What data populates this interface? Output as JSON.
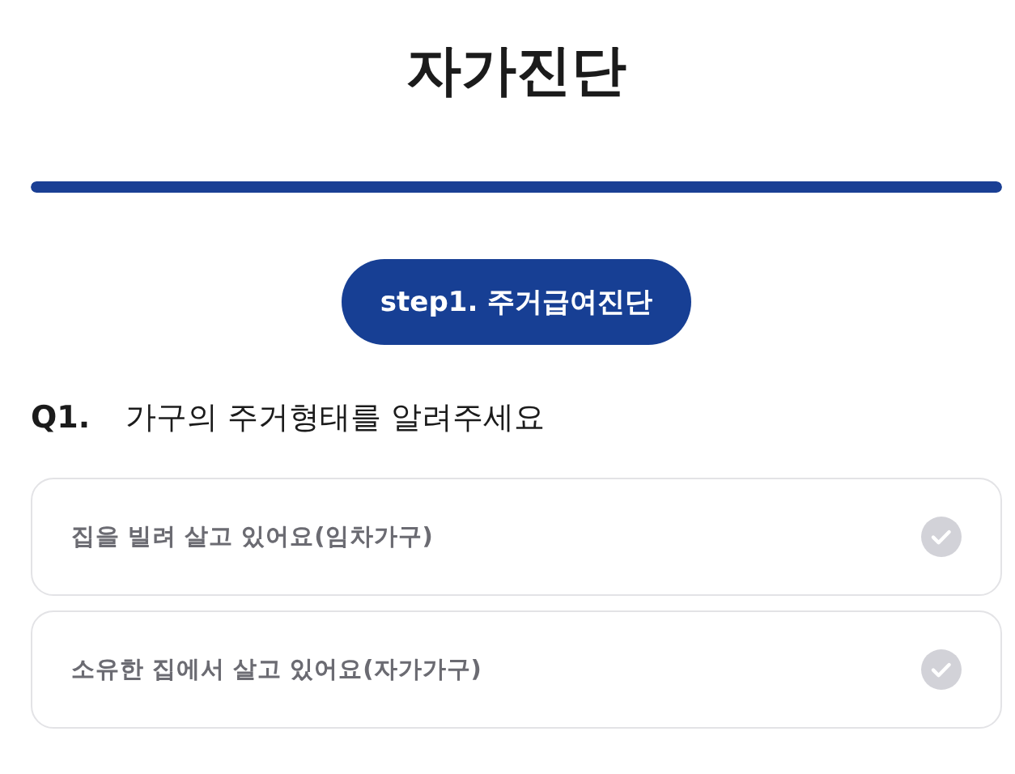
{
  "title": "자가진단",
  "progress": {
    "level": 1
  },
  "step_badge": "step1. 주거급여진단",
  "question": {
    "number": "Q1.",
    "text": "가구의 주거형태를 알려주세요"
  },
  "options": [
    {
      "label": "집을 빌려 살고 있어요(임차가구)",
      "selected": false
    },
    {
      "label": "소유한 집에서 살고 있어요(자가가구)",
      "selected": false
    }
  ]
}
